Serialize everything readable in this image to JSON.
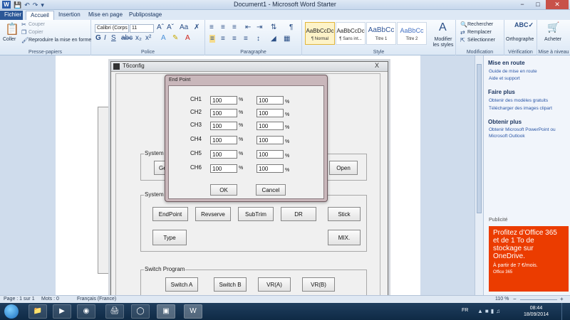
{
  "window": {
    "title": "Document1 - Microsoft Word Starter",
    "controls": [
      "−",
      "□",
      "✕"
    ]
  },
  "tabs": [
    "Fichier",
    "Accueil",
    "Insertion",
    "Mise en page",
    "Publipostage"
  ],
  "ribbon": {
    "clipboard": {
      "paste": "Coller",
      "cut": "Couper",
      "copy": "Copier",
      "format_painter": "Reproduire la mise en forme",
      "label": "Presse-papiers"
    },
    "font": {
      "name": "Calibri (Corps",
      "size": "11",
      "label": "Police"
    },
    "paragraph": {
      "label": "Paragraphe"
    },
    "styles": {
      "items": [
        {
          "preview": "AaBbCcDc",
          "name": "¶ Normal"
        },
        {
          "preview": "AaBbCcDc",
          "name": "¶ Sans int..."
        },
        {
          "preview": "AaBbCc",
          "name": "Titre 1"
        },
        {
          "preview": "AaBbCc",
          "name": "Titre 2"
        }
      ],
      "modify": "Modifier les styles",
      "label": "Style"
    },
    "editing": {
      "search": "Rechercher",
      "replace": "Remplacer",
      "select": "Sélectionner",
      "label": "Modification"
    },
    "proofing": {
      "spelling": "Orthographe",
      "label": "Vérification"
    },
    "buy": {
      "label_btn": "Acheter",
      "label": "Mise à niveau"
    }
  },
  "right_pane": {
    "sections": [
      {
        "title": "Mise en route",
        "links": [
          "Guide de mise en route",
          "Aide et support"
        ]
      },
      {
        "title": "Faire plus",
        "links": [
          "Obtenir des modèles gratuits",
          "Télécharger des images clipart"
        ]
      },
      {
        "title": "Obtenir plus",
        "links": [
          "Obtenir Microsoft PowerPoint ou",
          "Microsoft Outlook"
        ]
      }
    ],
    "ad_label": "Publicité",
    "ad": {
      "title": "Profitez d’Office 365 et de 1 To de stockage sur OneDrive.",
      "price": "À partir de 7 €/mois.",
      "brand": "Office 365"
    }
  },
  "t6config": {
    "title": "T6config",
    "close": "X",
    "group_system_top": "System",
    "get_button": "Get",
    "open_button": "Open",
    "group_system": "System",
    "system_buttons": [
      "EndPoint",
      "Revserve",
      "SubTrim",
      "DR",
      "Stick",
      "Type",
      "MIX."
    ],
    "group_switch": "Switch Program",
    "switch_buttons": [
      "Switch A",
      "Switch B",
      "VR(A)",
      "VR(B)"
    ]
  },
  "endpoint": {
    "title": "End Point",
    "channels": [
      {
        "label": "CH1",
        "left": "100",
        "right": "100"
      },
      {
        "label": "CH2",
        "left": "100",
        "right": "100"
      },
      {
        "label": "CH3",
        "left": "100",
        "right": "100"
      },
      {
        "label": "CH4",
        "left": "100",
        "right": "100"
      },
      {
        "label": "CH5",
        "left": "100",
        "right": "100"
      },
      {
        "label": "CH6",
        "left": "100",
        "right": "100"
      }
    ],
    "pct": "%",
    "ok": "OK",
    "cancel": "Cancel"
  },
  "statusbar": {
    "page": "Page : 1 sur 1",
    "words": "Mots : 0",
    "language": "Français (France)",
    "zoom": "110 %"
  },
  "taskbar": {
    "lang": "FR",
    "time": "08:44",
    "date": "18/09/2014"
  }
}
